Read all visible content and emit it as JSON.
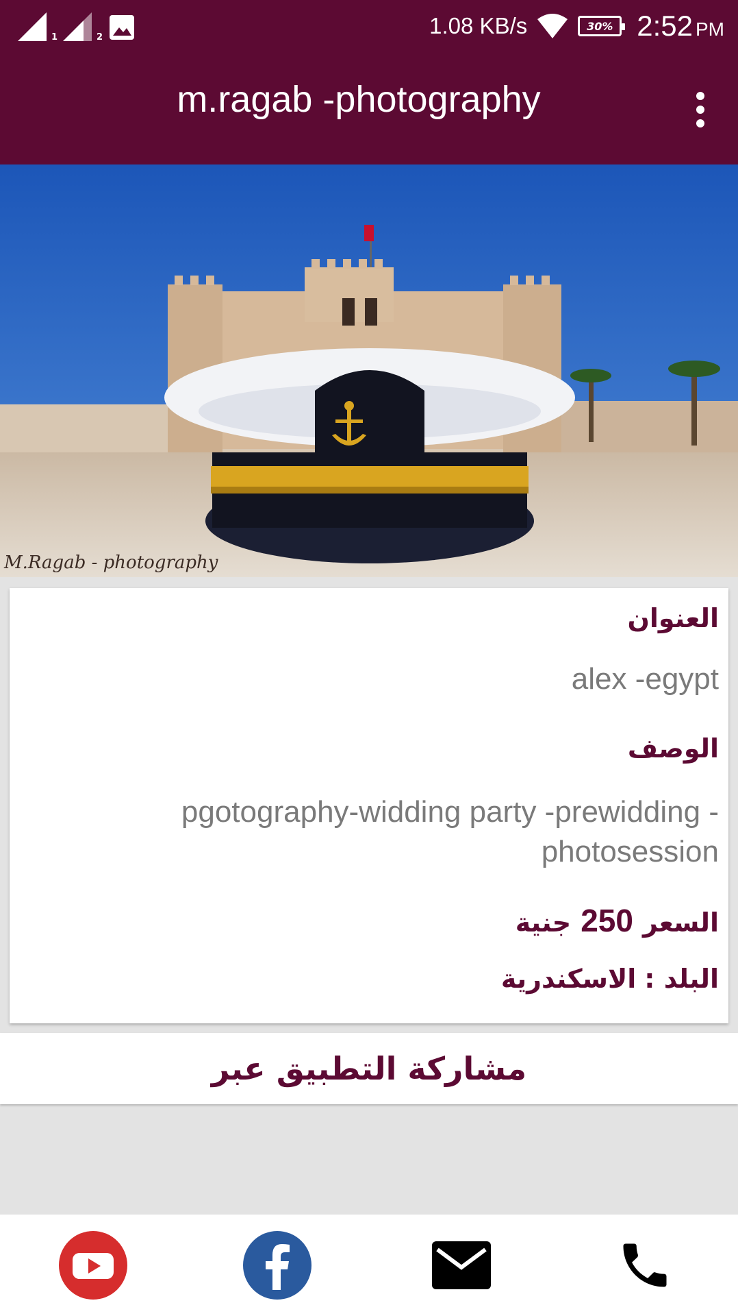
{
  "status_bar": {
    "sim1_label": "1",
    "sim2_label": "2",
    "speed": "1.08 KB/s",
    "battery": "30%",
    "time": "2:52",
    "ampm": "PM",
    "icons": [
      "signal-icon",
      "signal-icon",
      "gallery-icon",
      "wifi-icon",
      "battery-icon"
    ]
  },
  "app_bar": {
    "title": "m.ragab -photography",
    "menu_icon": "overflow-menu-icon"
  },
  "hero": {
    "watermark": "M.Ragab - photography"
  },
  "details": {
    "address_label": "العنوان",
    "address_value": "alex -egypt",
    "description_label": "الوصف",
    "description_value": "pgotography-widding party -prewidding -photosession",
    "price_label": "السعر",
    "price_value": "250",
    "price_currency": "جنية",
    "country_label": "البلد :",
    "country_value": "الاسكندرية"
  },
  "share": {
    "label": "مشاركة التطبيق عبر"
  },
  "bottom_nav": {
    "items": [
      "youtube-icon",
      "facebook-icon",
      "email-icon",
      "phone-icon"
    ]
  },
  "colors": {
    "primary": "#5c0a33",
    "youtube": "#d62d2d",
    "facebook": "#2a5a9e"
  }
}
